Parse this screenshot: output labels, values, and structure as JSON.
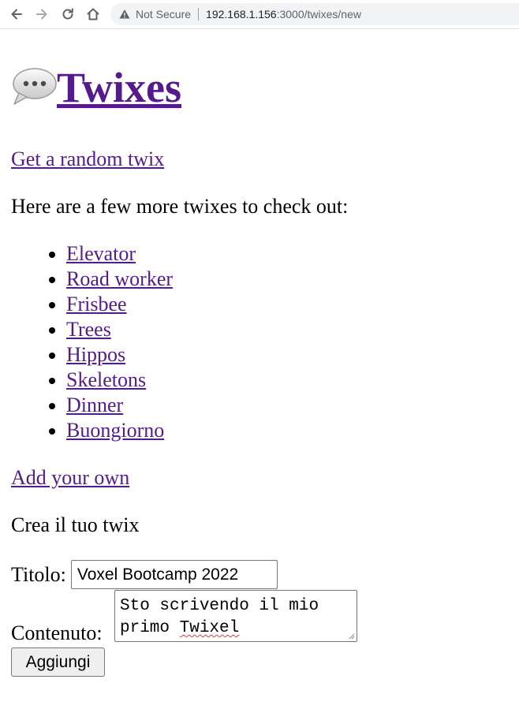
{
  "browser": {
    "security_label": "Not Secure",
    "url_host": "192.168.1.156",
    "url_rest": ":3000/twixes/new",
    "icons": [
      "back-arrow-icon",
      "forward-arrow-icon",
      "reload-icon",
      "home-icon",
      "warning-icon"
    ]
  },
  "page": {
    "logo_text": "Twixes",
    "logo_icon": "speech-bubble-icon",
    "random_link": "Get a random twix",
    "more_text": "Here are a few more twixes to check out:",
    "twixes": [
      "Elevator",
      "Road worker",
      "Frisbee",
      "Trees",
      "Hippos",
      "Skeletons",
      "Dinner",
      "Buongiorno"
    ],
    "add_link": "Add your own"
  },
  "form": {
    "heading": "Crea il tuo twix",
    "title_label": "Titolo:",
    "title_value": "Voxel Bootcamp 2022",
    "content_label": "Contenuto:",
    "content_value_line1": "Sto scrivendo il mio",
    "content_value_line2_prefix": "primo ",
    "content_value_line2_misspelled": "Twixel",
    "submit_label": "Aggiungi"
  },
  "colors": {
    "link": "#551a8b",
    "spellcheck": "#e53935"
  }
}
